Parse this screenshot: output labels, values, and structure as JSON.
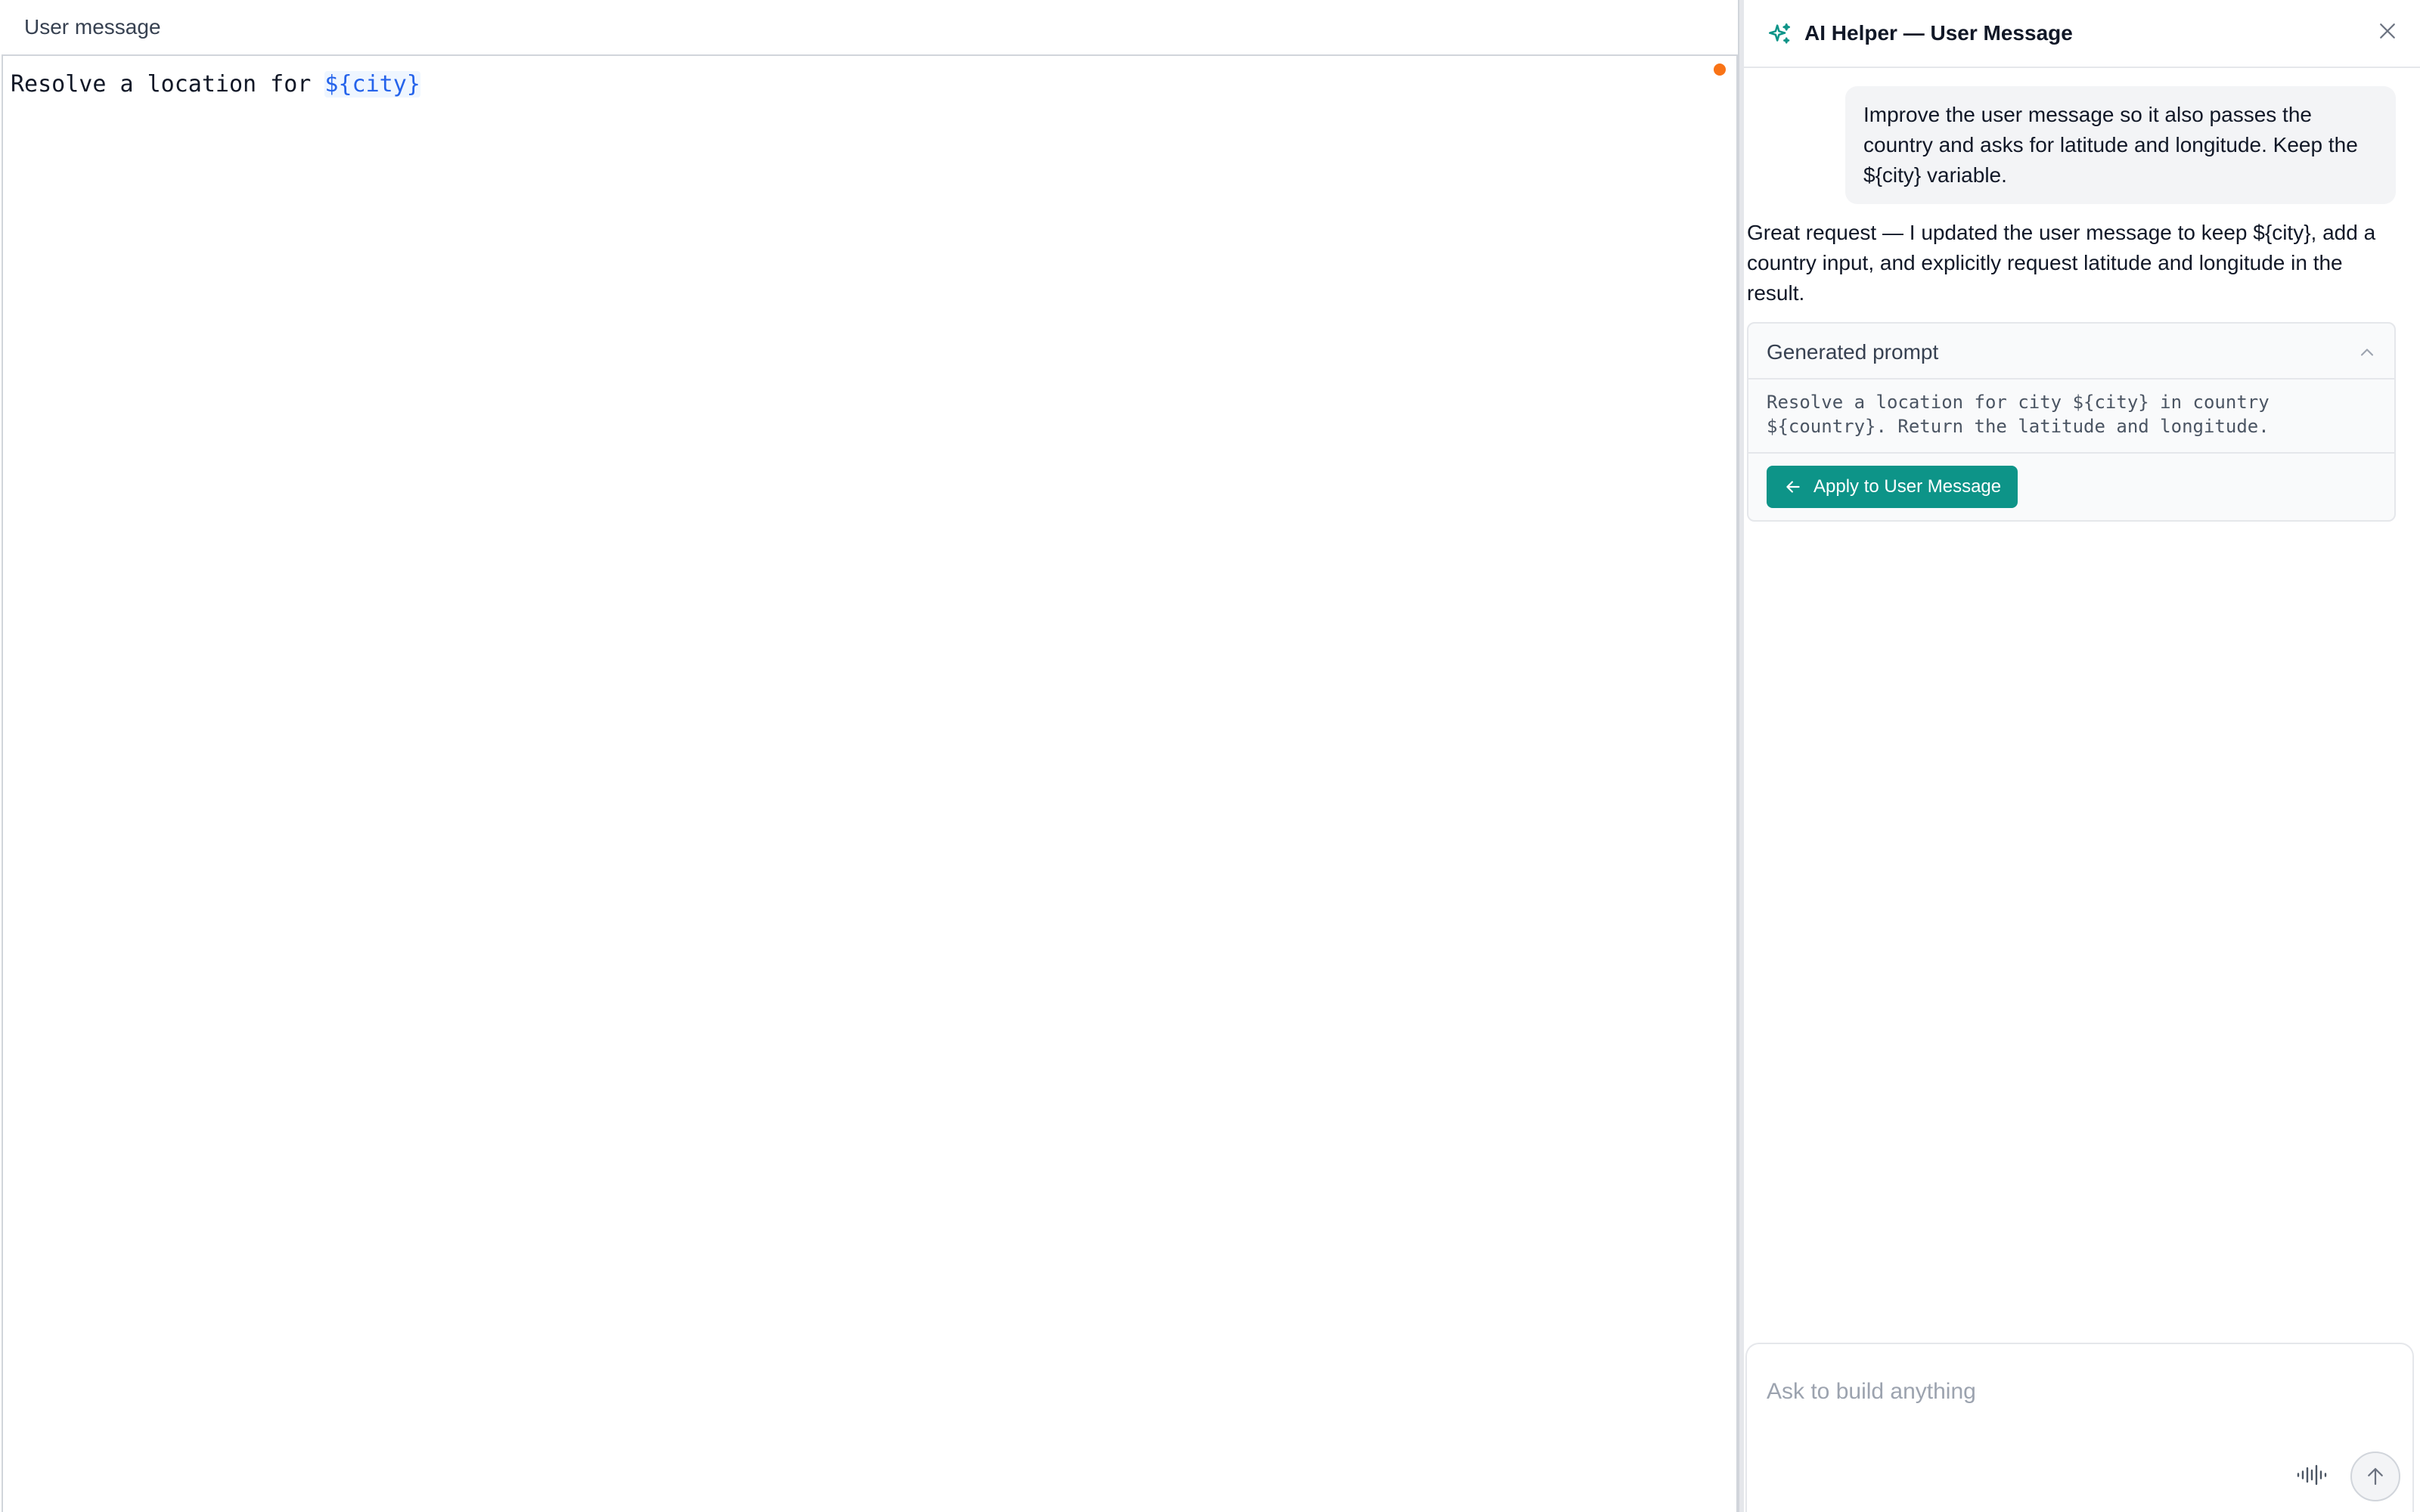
{
  "editor": {
    "title": "User message",
    "text_prefix": "Resolve a location for ",
    "text_variable": "${city}"
  },
  "helper": {
    "title": "AI Helper — User Message",
    "user_message": "Improve the user message so it also passes the country and asks for latitude and longitude. Keep the ${city} variable.",
    "assistant_message": "Great request — I updated the user message to keep ${city}, add a country input, and explicitly request latitude and longitude in the result.",
    "generated_prompt": {
      "title": "Generated prompt",
      "body": "Resolve a location for city ${city} in country ${country}. Return the latitude and longitude.",
      "apply_label": "Apply to User Message"
    },
    "composer": {
      "placeholder": "Ask to build anything"
    }
  },
  "colors": {
    "accent": "#0d9488",
    "variable": "#2563eb",
    "unsaved_dot": "#f97316"
  },
  "icons": [
    "sparkle-icon",
    "close-icon",
    "chevron-up-icon",
    "arrow-left-icon",
    "microphone-icon",
    "arrow-up-icon"
  ]
}
